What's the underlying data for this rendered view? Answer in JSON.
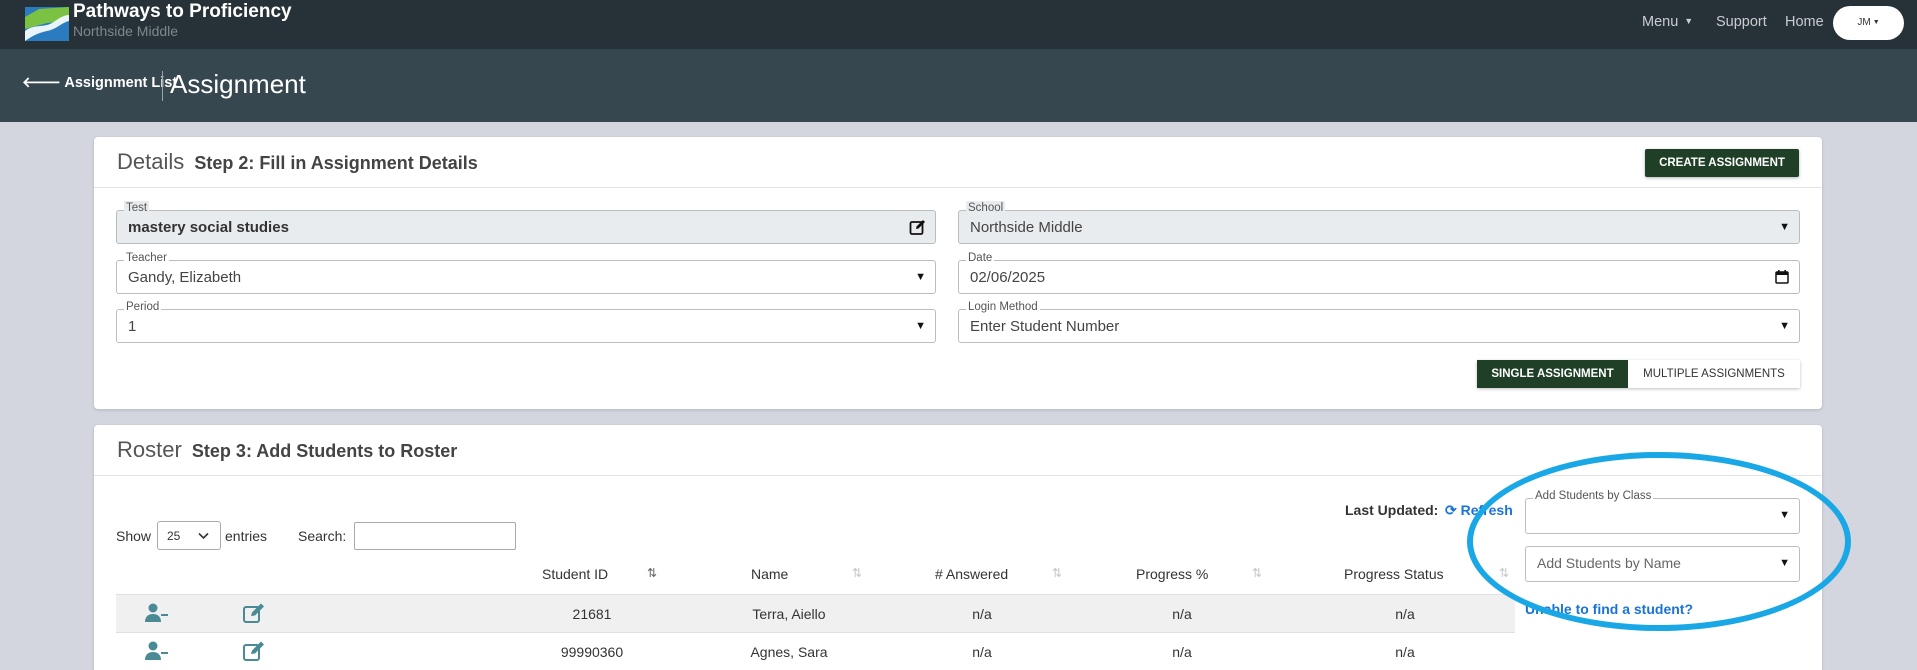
{
  "app": {
    "title": "Pathways to Proficiency",
    "school": "Northside Middle"
  },
  "nav": {
    "menu": "Menu",
    "support": "Support",
    "home": "Home",
    "user_initials": "JM"
  },
  "subheader": {
    "back_label": "Assignment List",
    "title": "Assignment"
  },
  "details": {
    "title": "Details",
    "step": "Step 2: Fill in Assignment Details",
    "create_button": "CREATE ASSIGNMENT",
    "fields": {
      "test": {
        "label": "Test",
        "value": "mastery social studies"
      },
      "school": {
        "label": "School",
        "value": "Northside Middle"
      },
      "teacher": {
        "label": "Teacher",
        "value": "Gandy, Elizabeth"
      },
      "date": {
        "label": "Date",
        "value": "02/06/2025"
      },
      "period": {
        "label": "Period",
        "value": "1"
      },
      "login_method": {
        "label": "Login Method",
        "value": "Enter Student Number"
      }
    },
    "toggle": {
      "single": "SINGLE ASSIGNMENT",
      "multiple": "MULTIPLE ASSIGNMENTS",
      "selected": "single"
    }
  },
  "roster": {
    "title": "Roster",
    "step": "Step 3: Add Students to Roster",
    "last_updated_label": "Last Updated:",
    "refresh_label": "Refresh",
    "add_by_class_label": "Add Students by Class",
    "add_by_class_value": "",
    "add_by_name_placeholder": "Add Students by Name",
    "unable_link": "Unable to find a student?",
    "show_label": "Show",
    "show_value": "25",
    "entries_label": "entries",
    "search_label": "Search:",
    "search_value": "",
    "columns": [
      "Student ID",
      "Name",
      "# Answered",
      "Progress %",
      "Progress Status"
    ],
    "rows": [
      {
        "student_id": "21681",
        "name": "Terra, Aiello",
        "answered": "n/a",
        "progress_pct": "n/a",
        "progress_status": "n/a"
      },
      {
        "student_id": "99990360",
        "name": "Agnes, Sara",
        "answered": "n/a",
        "progress_pct": "n/a",
        "progress_status": "n/a"
      }
    ]
  },
  "colors": {
    "nav_bg": "#273238",
    "subheader_bg": "#36474f",
    "primary_button": "#1f4027",
    "link_blue": "#1a73d8",
    "annotation_circle": "#1aa7e5",
    "row_icon": "#4a8a95"
  },
  "icons": [
    "logo-icon",
    "arrow-left-icon",
    "edit-icon",
    "calendar-icon",
    "refresh-icon",
    "chevron-down-icon",
    "remove-user-icon",
    "edit-row-icon",
    "sort-icon"
  ]
}
